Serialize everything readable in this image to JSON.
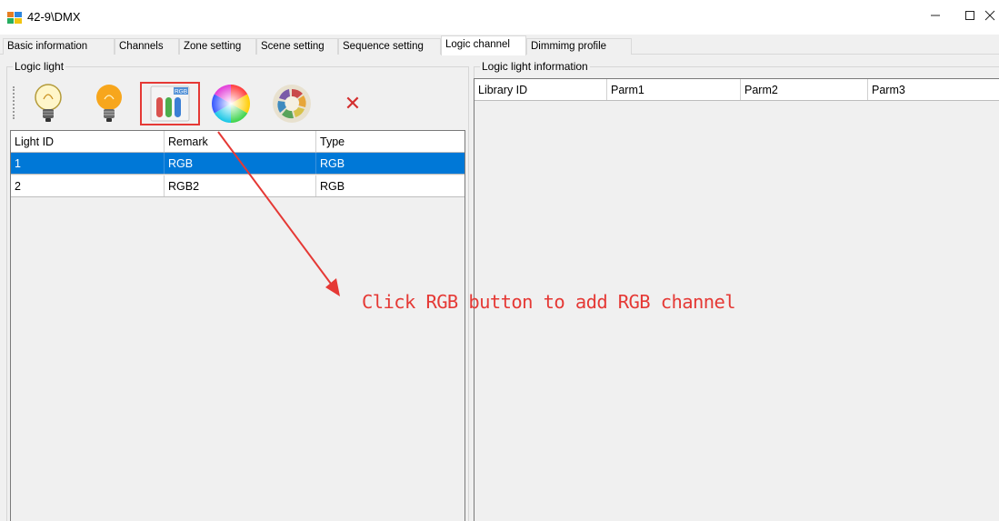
{
  "window": {
    "title": "42-9\\DMX",
    "minimize_glyph": "—",
    "maximize_glyph": "☐",
    "close_glyph": "✕"
  },
  "tabs": [
    {
      "label": "Basic information",
      "active": false
    },
    {
      "label": "Channels",
      "active": false
    },
    {
      "label": "Zone setting",
      "active": false
    },
    {
      "label": "Scene setting",
      "active": false
    },
    {
      "label": "Sequence setting",
      "active": false
    },
    {
      "label": "Logic channel",
      "active": true
    },
    {
      "label": "Dimmimg profile",
      "active": false
    }
  ],
  "logic_light": {
    "label": "Logic light",
    "toolbar": [
      {
        "icon": "bulb-icon"
      },
      {
        "icon": "orange-bulb-icon"
      },
      {
        "icon": "rgb-icon",
        "badge": "RGB",
        "highlighted": true
      },
      {
        "icon": "color-wheel-icon"
      },
      {
        "icon": "color-ring-icon"
      },
      {
        "icon": "delete-icon",
        "glyph": "✕",
        "color": "#d32f2f"
      }
    ],
    "columns": [
      "Light ID",
      "Remark",
      "Type"
    ],
    "rows": [
      {
        "id": "1",
        "remark": "RGB",
        "type": "RGB",
        "selected": true
      },
      {
        "id": "2",
        "remark": "RGB2",
        "type": "RGB",
        "selected": false
      }
    ]
  },
  "logic_light_information": {
    "label": "Logic light information",
    "columns": [
      "Library ID",
      "Parm1",
      "Parm2",
      "Parm3"
    ]
  },
  "annotation": {
    "text": "Click RGB button to add RGB channel",
    "color": "#e53935"
  },
  "colors": {
    "selection": "#0078d7",
    "highlight": "#e53935"
  }
}
